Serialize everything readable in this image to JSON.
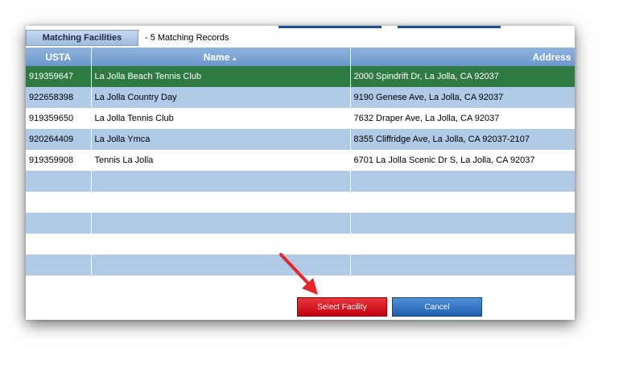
{
  "tab": {
    "label": "Matching Facilities",
    "record_count": "- 5 Matching Records"
  },
  "table": {
    "columns": [
      "USTA",
      "Name",
      "Address"
    ],
    "sort_indicator": "▲",
    "rows": [
      {
        "usta": "919359647",
        "name": "La Jolla Beach Tennis Club",
        "address": "2000 Spindrift Dr, La Jolla, CA 92037",
        "selected": true
      },
      {
        "usta": "922658398",
        "name": "La Jolla Country Day",
        "address": "9190 Genese Ave, La Jolla, CA 92037"
      },
      {
        "usta": "919359650",
        "name": "La Jolla Tennis Club",
        "address": "7632 Draper Ave, La Jolla, CA 92037"
      },
      {
        "usta": "920264409",
        "name": "La Jolla Ymca",
        "address": "8355 Cliffridge Ave, La Jolla, CA 92037-2107"
      },
      {
        "usta": "919359908",
        "name": "Tennis La Jolla",
        "address": "6701 La Jolla Scenic Dr S, La Jolla, CA 92037"
      },
      {
        "usta": "",
        "name": "",
        "address": ""
      },
      {
        "usta": "",
        "name": "",
        "address": ""
      },
      {
        "usta": "",
        "name": "",
        "address": ""
      },
      {
        "usta": "",
        "name": "",
        "address": ""
      },
      {
        "usta": "",
        "name": "",
        "address": ""
      }
    ]
  },
  "buttons": {
    "select": "Select Facility",
    "cancel": "Cancel"
  },
  "colors": {
    "selected_row": "#2e7a42",
    "alt_row": "#b0cae8",
    "header": "#7aa3d6",
    "select_button": "#d0101c",
    "cancel_button": "#2a6bbd",
    "arrow": "#e8242a"
  }
}
